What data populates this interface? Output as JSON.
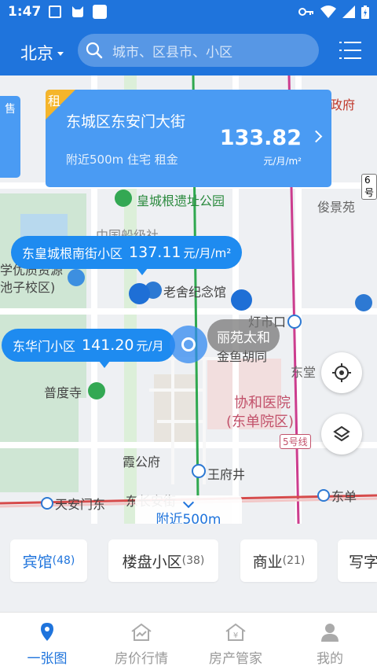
{
  "status_bar": {
    "time": "1:47"
  },
  "header": {
    "city": "北京",
    "search_placeholder": "城市、区县市、小区"
  },
  "map": {
    "labels": {
      "fu": "政府",
      "junjing": "俊景苑",
      "park": "皇城根遗址公园",
      "zhongguo": "中国船级社",
      "zixuan": "学优质资源",
      "chizi": "池子校区)",
      "laoshe": "老舍纪念馆",
      "dengshikou": "灯市口",
      "jinyu": "金鱼胡同",
      "dongtang": "东堂",
      "putidu": "普度寺",
      "xiehe1": "协和医院",
      "xiehe2": "(东单院区)",
      "line5": "5号线",
      "xiagong": "霞公府",
      "wangfujing": "王府井",
      "tiananmen": "天安门东",
      "dongchangan": "东长安街",
      "dongdan": "东单",
      "road6": "6号",
      "side_tag": "售"
    },
    "main_card": {
      "tag": "租",
      "title": "东城区东安门大街",
      "price": "133.82",
      "subtitle": "附近500m 住宅 租金",
      "unit": "元/月/m²"
    },
    "bubbles": [
      {
        "name": "东皇城根南街小区",
        "price": "137.11",
        "unit": "元/月/m²"
      },
      {
        "name": "东华门小区",
        "price": "141.20",
        "unit": "元/月"
      }
    ],
    "gray_bubble": "丽苑太和",
    "nearby_label": "附近500m"
  },
  "categories": [
    {
      "label": "宾馆",
      "count": "(48)",
      "active": true
    },
    {
      "label": "楼盘小区",
      "count": "(38)",
      "active": false
    },
    {
      "label": "商业",
      "count": "(21)",
      "active": false
    },
    {
      "label": "写字",
      "count": "",
      "active": false
    }
  ],
  "nav": [
    {
      "label": "一张图",
      "icon": "map-pin-icon",
      "active": true
    },
    {
      "label": "房价行情",
      "icon": "price-trend-house-icon",
      "active": false
    },
    {
      "label": "房产管家",
      "icon": "property-manager-house-icon",
      "active": false
    },
    {
      "label": "我的",
      "icon": "user-profile-icon",
      "active": false
    }
  ],
  "colors": {
    "primary": "#1f74dc",
    "card": "#4a9bf3",
    "tag": "#f5b52b"
  }
}
